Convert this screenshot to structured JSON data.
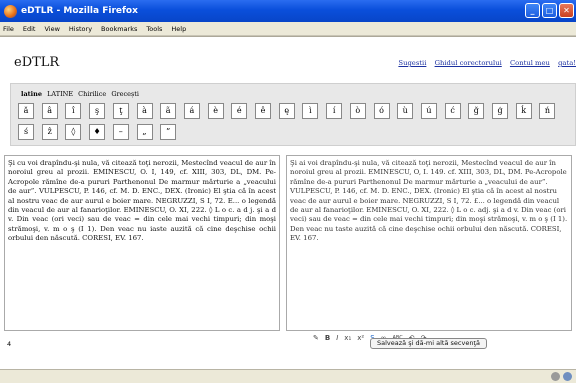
{
  "window": {
    "title": "eDTLR - Mozilla Firefox",
    "controls": [
      "_",
      "□",
      "✕"
    ]
  },
  "menu": [
    "File",
    "Edit",
    "View",
    "History",
    "Bookmarks",
    "Tools",
    "Help"
  ],
  "menu_underline": [
    "F",
    "E",
    "V",
    "s",
    "B",
    "T",
    "H"
  ],
  "site": {
    "title": "eDTLR"
  },
  "toplinks": [
    "Sugestii",
    "Ghidul corectorului",
    "Contul meu",
    "gata!"
  ],
  "tabs": {
    "active": "latine",
    "others": [
      "LATINE",
      "Chirilice",
      "Grecești"
    ]
  },
  "char_row1": [
    "ă",
    "â",
    "î",
    "ş",
    "ţ",
    "à",
    "ã",
    "á",
    "è",
    "é",
    "ê",
    "ę",
    "ì",
    "í",
    "ò",
    "ó",
    "ù",
    "ú",
    "ć",
    "ğ",
    "ģ",
    "ḱ",
    "ń"
  ],
  "char_row2": [
    "ś",
    "ẑ",
    "◊",
    "♦",
    "–",
    "„",
    "”"
  ],
  "left_text": "Şi cu voi drapîndu-şi nula, vă citează toţi nerozii, Mestecînd veacul de aur în noroiul greu al prozii. EMINESCU, O. I, 149, cf. XIII, 303, DL, DM. Pe-Acropole rămîne de-a pururi Parthenonul De marmur mărturie a „veacului de aur”. VULPESCU, P. 146, cf. M. D. ENC., DEX. (Ironic) El ştia că în acest al nostru veac de aur aurul e boier mare. NEGRUZZI, S I, 72. E... o legendă din veacul de aur al fanarioţilor. EMINESCU, O. XI, 222. ◊ L o c. a d j. şi a d v. Din veac (ori veci) sau de veac = din cele mai vechi timpuri; din moşi strămoşi, v. m o ş (I 1). Den veac nu iaste auzită că cine deşchise ochii orbului den născută. CORESI, EV. 167.",
  "right_text": "Şi ai voi drapîndu-şi nula, vă citează toţi nerozii, Mestecînd veacul de aur în noroiul greu al prozii. EMINESCU, O, I. 149. cf. XIII, 303, DL, DM. Pe-Acropole rămîne de-a pururi Parthenonul De marmur mărturie a „veacului de aur”. VULPESCU, P. 146, cf. M. D. ENC., DEX. (Ironic) El ştia că în acest al nostru veac de aur aurul e boier mare. NEGRUZZI, S I, 72. £... o legendă din veacul de aur al fanarioţilor. EMINESCU, O. XI, 222. ◊ L o c. adj. şi a d v. Din veac (ori veci) sau de veac = din cele mai vechi timpuri; din moşi strămoşi, v. m o ş (I 1). Den veac nu taste auzită că cine deşchise ochii orbului den născută. CORESI, EV. 167.",
  "format_toolbar": [
    "✎",
    "B",
    "I",
    "x₁",
    "x²",
    "S",
    "∞",
    "ABC",
    "↶",
    "↷"
  ],
  "counter": "4",
  "save_button": "Salvează şi dă-mi altă secvenţă",
  "colors": {
    "title_bar": "#0a4fdb",
    "link": "#1a2fa0",
    "panel": "#e8e8e8"
  },
  "icons": {
    "app": "firefox-icon",
    "status": [
      "status-icon-1",
      "status-icon-2"
    ]
  }
}
